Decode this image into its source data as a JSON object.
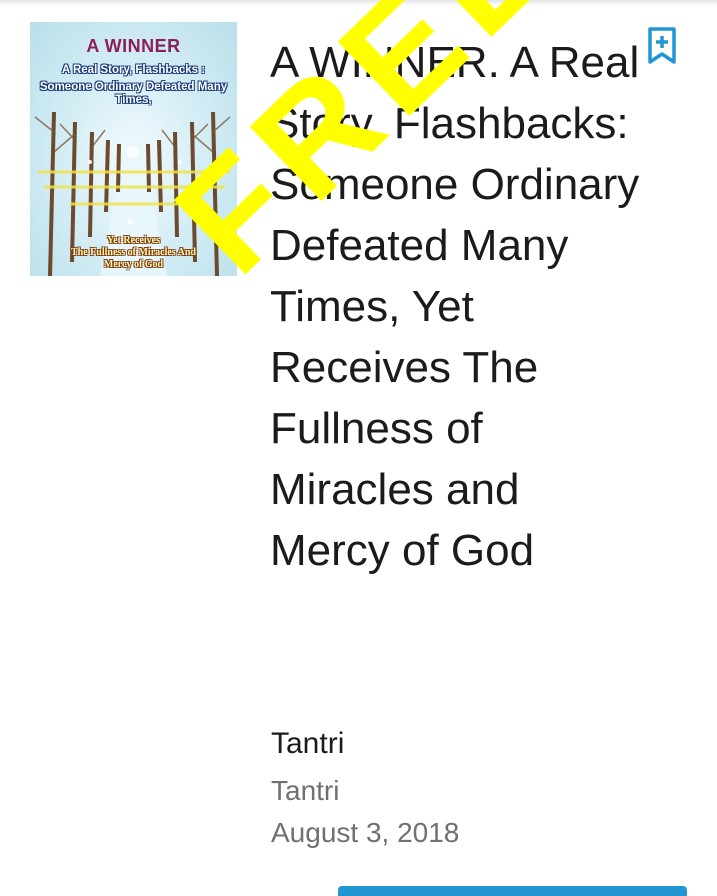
{
  "book": {
    "title": "A WINNER. A Real Story, Flashbacks: Someone Ordinary Defeated Many Times, Yet Receives The Fullness of Miracles and Mercy of God",
    "author": "Tantri",
    "publisher": "Tantri",
    "date": "August 3, 2018"
  },
  "cover": {
    "title": "A WINNER",
    "subtitle_line1": "A Real Story, Flashbacks :",
    "subtitle_line2": "Someone Ordinary Defeated Many Times,",
    "footer_line1": "Yet Receives",
    "footer_line2": "The Fullness of Miracles And",
    "footer_line3": "Mercy of God"
  },
  "overlay": {
    "stamp_text": "FREE",
    "stamp_color": "#ffff00"
  },
  "icons": {
    "bookmark": "bookmark-add-icon"
  },
  "colors": {
    "accent": "#2196d3",
    "title_text": "#1b1b1b",
    "secondary_text": "#707070"
  }
}
